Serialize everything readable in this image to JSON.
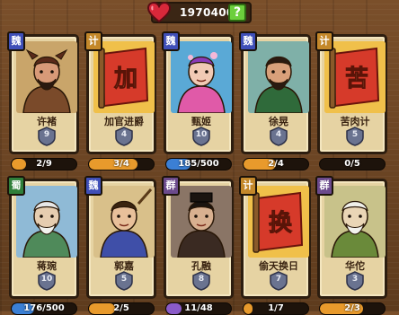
{
  "header": {
    "gold": "1970400",
    "help_label": "?"
  },
  "colors": {
    "orange": "#e89a2c",
    "blue": "#3b7fd4",
    "purple": "#8a5bc8"
  },
  "cards": [
    {
      "badge": "魏",
      "name": "许褚",
      "level": "9",
      "progress": "2/9",
      "fill": 0.22,
      "bar": "orange",
      "art": "warrior",
      "badge_class": "b-wei"
    },
    {
      "badge": "计",
      "name": "加官进爵",
      "level": "4",
      "progress": "3/4",
      "fill": 0.75,
      "bar": "orange",
      "art": "scroll-jia",
      "badge_class": "b-ji"
    },
    {
      "badge": "魏",
      "name": "甄姬",
      "level": "10",
      "progress": "185/500",
      "fill": 0.37,
      "bar": "blue",
      "art": "lady",
      "badge_class": "b-wei"
    },
    {
      "badge": "魏",
      "name": "徐晃",
      "level": "4",
      "progress": "2/4",
      "fill": 0.5,
      "bar": "orange",
      "art": "general",
      "badge_class": "b-wei"
    },
    {
      "badge": "计",
      "name": "苦肉计",
      "level": "5",
      "progress": "0/5",
      "fill": 0,
      "bar": "orange",
      "art": "scroll-ku",
      "badge_class": "b-ji"
    },
    {
      "badge": "蜀",
      "name": "蒋琬",
      "level": "10",
      "progress": "176/500",
      "fill": 0.35,
      "bar": "blue",
      "art": "elder",
      "badge_class": "b-shu"
    },
    {
      "badge": "魏",
      "name": "郭嘉",
      "level": "5",
      "progress": "2/5",
      "fill": 0.4,
      "bar": "orange",
      "art": "strategist",
      "badge_class": "b-wei"
    },
    {
      "badge": "群",
      "name": "孔融",
      "level": "8",
      "progress": "11/48",
      "fill": 0.23,
      "bar": "purple",
      "art": "scholar",
      "badge_class": "b-qun"
    },
    {
      "badge": "计",
      "name": "偷天换日",
      "level": "7",
      "progress": "1/7",
      "fill": 0.14,
      "bar": "orange",
      "art": "scroll-huan",
      "badge_class": "b-ji"
    },
    {
      "badge": "群",
      "name": "华佗",
      "level": "3",
      "progress": "2/3",
      "fill": 0.67,
      "bar": "orange",
      "art": "doctor",
      "badge_class": "b-qun"
    }
  ],
  "art_glyphs": {
    "scroll-jia": "加",
    "scroll-ku": "苦",
    "scroll-huan": "换"
  }
}
